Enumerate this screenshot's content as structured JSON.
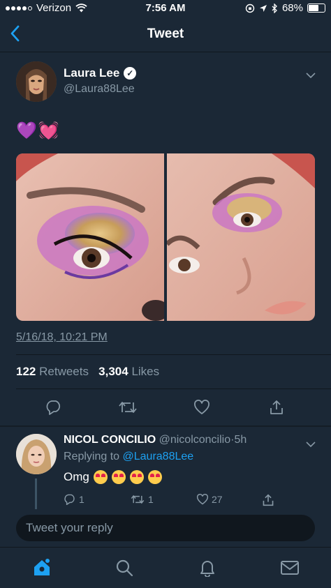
{
  "status_bar": {
    "carrier": "Verizon",
    "time": "7:56 AM",
    "battery": "68%",
    "battery_level": 0.68
  },
  "nav": {
    "back_icon": "chevron-left-icon",
    "title": "Tweet"
  },
  "tweet": {
    "author_name": "Laura Lee",
    "verified": true,
    "author_handle": "@Laura88Lee",
    "text_emojis": [
      "💜",
      "💓"
    ],
    "media": [
      "eye-makeup-photo-left",
      "eye-makeup-photo-right"
    ],
    "timestamp": "5/16/18, 10:21 PM",
    "retweets_count": "122",
    "retweets_label": "Retweets",
    "likes_count": "3,304",
    "likes_label": "Likes",
    "actions": [
      "reply-icon",
      "retweet-icon",
      "like-icon",
      "share-icon"
    ]
  },
  "reply": {
    "author_name": "NICOL CONCILIO",
    "author_handle": "@nicolconcilio",
    "separator": "·",
    "time": "5h",
    "replying_prefix": "Replying to",
    "replying_to": "@Laura88Lee",
    "text": "Omg",
    "emoji_count": 4,
    "emoji": "😍",
    "reply_count": "1",
    "retweet_count": "1",
    "like_count": "27"
  },
  "reply_box": {
    "placeholder": "Tweet your reply"
  },
  "tab_bar": {
    "items": [
      "home-icon",
      "search-icon",
      "notifications-icon",
      "messages-icon"
    ],
    "active_color": "#1da1f2"
  },
  "colors": {
    "background": "#1b2836",
    "accent": "#1da1f2",
    "secondary_text": "#8899a6"
  }
}
